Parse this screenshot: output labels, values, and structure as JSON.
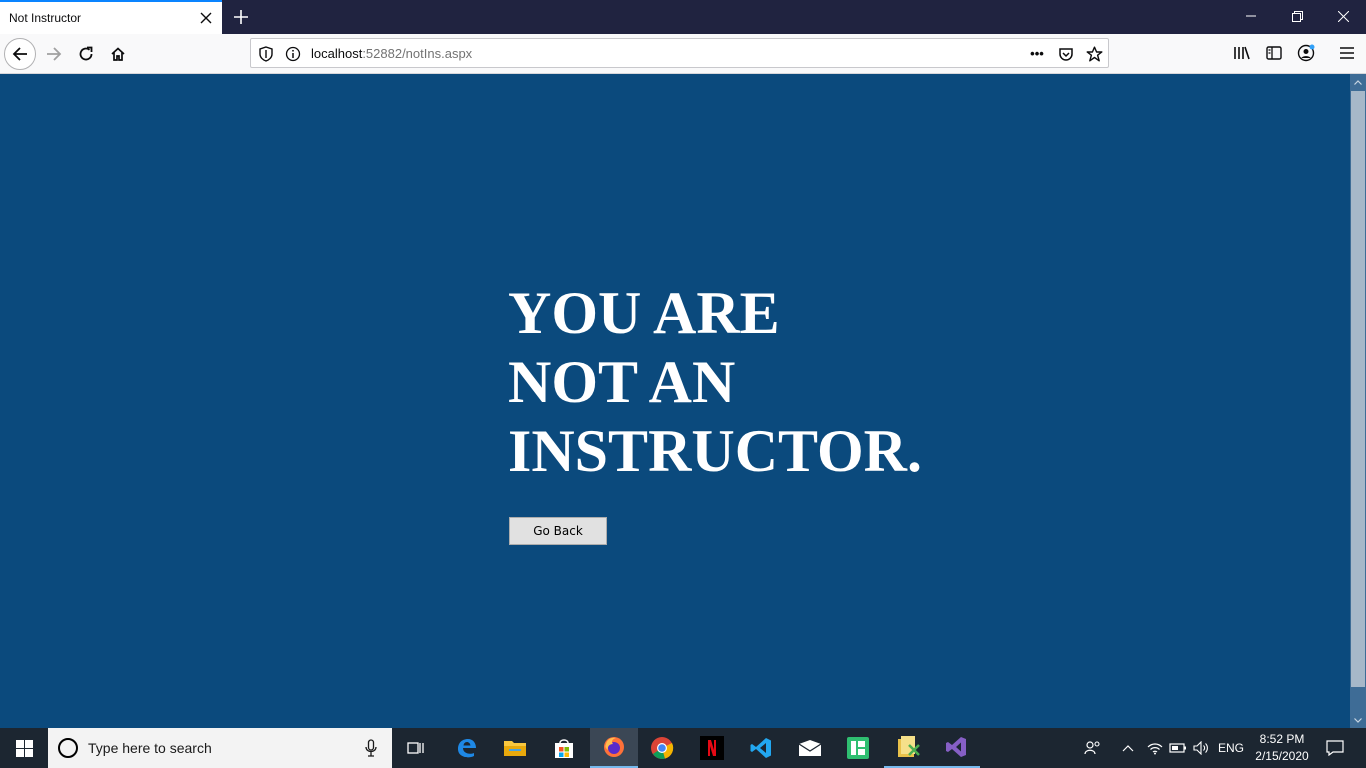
{
  "browser": {
    "tab_title": "Not Instructor",
    "url_host": "localhost",
    "url_rest": ":52882/notIns.aspx",
    "page_actions_glyph": "•••"
  },
  "page": {
    "headline_lines": [
      "YOU ARE",
      "NOT AN",
      "INSTRUCTOR."
    ],
    "go_back_label": "Go Back",
    "background_color": "#0b4a7d",
    "text_color": "#ffffff"
  },
  "taskbar": {
    "search_placeholder": "Type here to search",
    "language": "ENG",
    "time": "8:52 PM",
    "date": "2/15/2020",
    "apps": [
      "task-view",
      "edge",
      "file-explorer",
      "microsoft-store",
      "firefox",
      "chrome",
      "netflix",
      "vscode",
      "mail",
      "app-green",
      "app-file-tool",
      "visual-studio"
    ]
  }
}
